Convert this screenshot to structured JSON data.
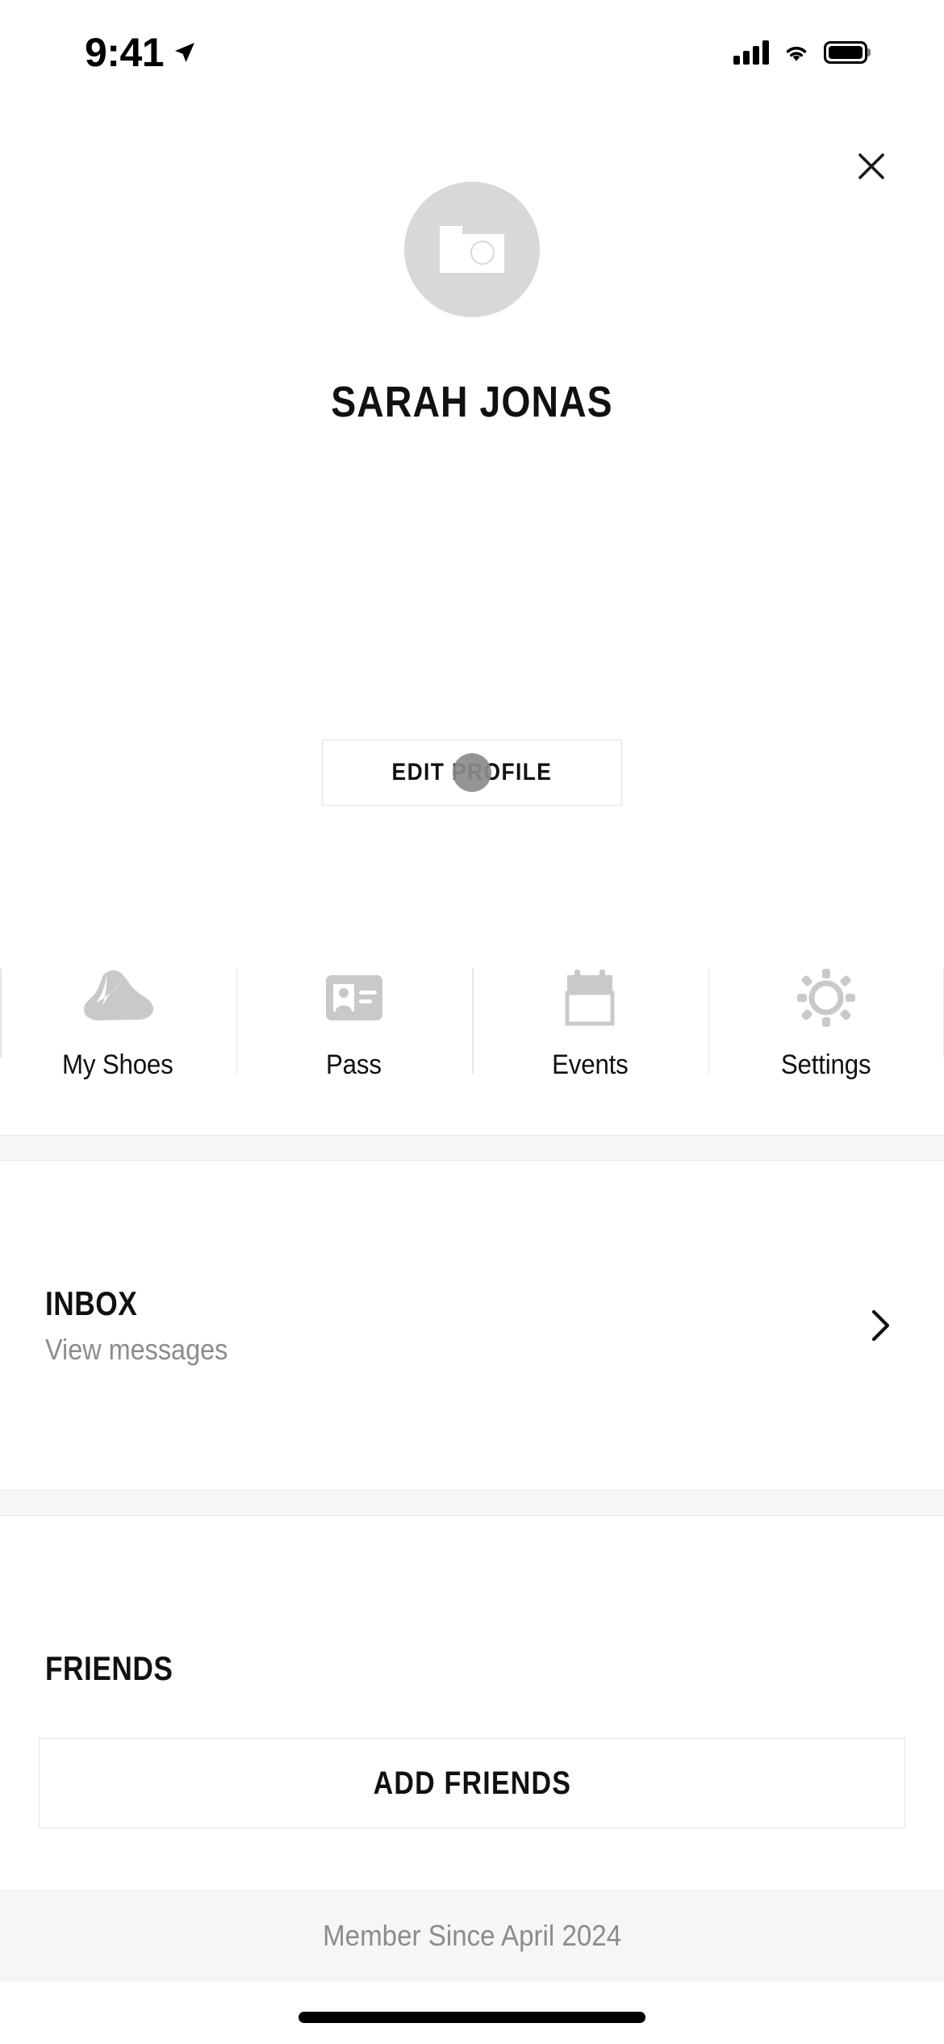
{
  "status_bar": {
    "time": "9:41",
    "location_icon": "location-arrow-icon",
    "signal_icon": "cellular-signal-icon",
    "wifi_icon": "wifi-icon",
    "battery_icon": "battery-full-icon"
  },
  "header": {
    "close_icon": "close-x-icon"
  },
  "profile": {
    "avatar_icon": "camera-placeholder-icon",
    "name": "SARAH JONAS",
    "edit_profile_label": "EDIT PROFILE",
    "tap_indicator": "touch-cursor-dot"
  },
  "quick_links": {
    "items": [
      {
        "label": "My Shoes",
        "icon": "sneaker-icon"
      },
      {
        "label": "Pass",
        "icon": "id-card-icon"
      },
      {
        "label": "Events",
        "icon": "calendar-icon"
      },
      {
        "label": "Settings",
        "icon": "gear-icon"
      }
    ]
  },
  "inbox": {
    "title": "INBOX",
    "subtitle": "View messages",
    "chevron_icon": "chevron-right-icon"
  },
  "friends": {
    "title": "FRIENDS",
    "add_label": "ADD FRIENDS"
  },
  "footer": {
    "member_since": "Member Since April 2024"
  },
  "colors": {
    "text_primary": "#111111",
    "text_muted": "#8c8c8c",
    "avatar_bg": "#d8d8d8",
    "icon_gray": "#c9c9cc",
    "band_bg": "#f6f6f8",
    "border": "#e6e6e6"
  }
}
